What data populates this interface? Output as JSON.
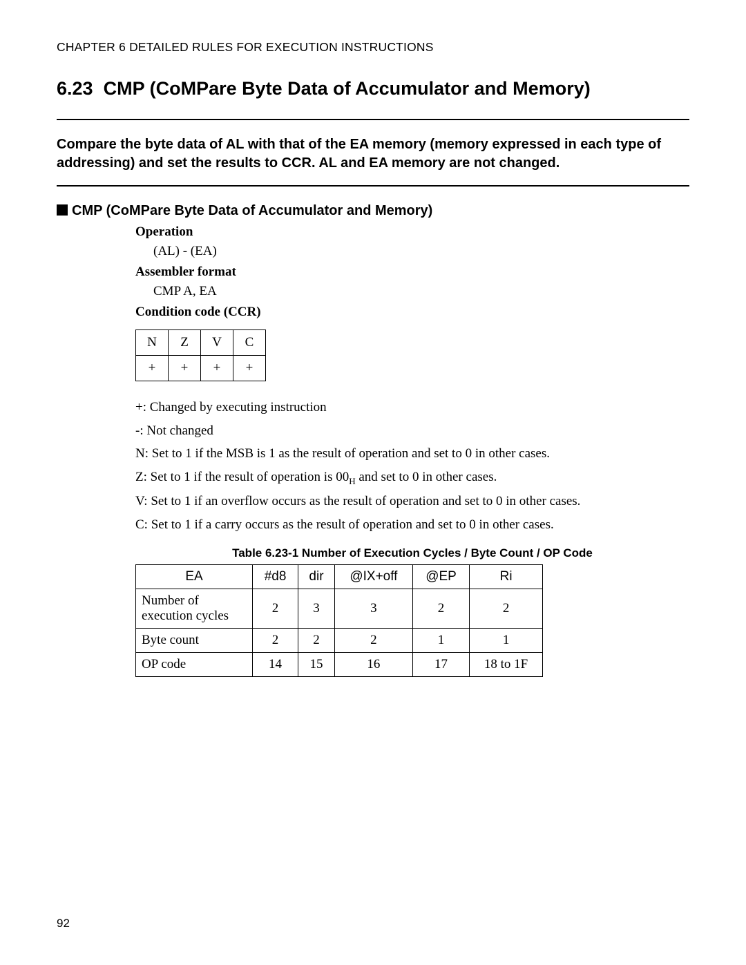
{
  "chapter_header": "CHAPTER 6  DETAILED RULES FOR EXECUTION INSTRUCTIONS",
  "section_number": "6.23",
  "section_title": "CMP (CoMPare Byte Data of Accumulator and Memory)",
  "intro_text": "Compare the byte data of AL with that of the EA memory (memory expressed in each type of addressing) and set the results to CCR. AL and EA memory are not changed.",
  "subheading": "CMP (CoMPare Byte Data of Accumulator and Memory)",
  "labels": {
    "operation": "Operation",
    "operation_value": "(AL) - (EA)",
    "assembler": "Assembler format",
    "assembler_value": "CMP A, EA",
    "condition": "Condition code (CCR)"
  },
  "ccr": {
    "headers": [
      "N",
      "Z",
      "V",
      "C"
    ],
    "values": [
      "+",
      "+",
      "+",
      "+"
    ]
  },
  "notes": {
    "plus": "+: Changed by executing instruction",
    "minus": "-: Not changed",
    "n": "N: Set to 1 if the MSB is 1 as the result of operation and set to 0 in other cases.",
    "z_pre": "Z: Set to 1 if the result of operation is 00",
    "z_sub": "H",
    "z_post": " and set to 0 in other cases.",
    "v": "V: Set to 1 if an overflow occurs as the result of operation and set to 0 in other cases.",
    "c": "C: Set to 1 if a carry occurs as the result of operation and set to 0 in other cases."
  },
  "table_caption": "Table 6.23-1  Number of Execution Cycles / Byte Count / OP Code",
  "table": {
    "headers": [
      "EA",
      "#d8",
      "dir",
      "@IX+off",
      "@EP",
      "Ri"
    ],
    "rows": [
      {
        "label": "Number of execution cycles",
        "cells": [
          "2",
          "3",
          "3",
          "2",
          "2"
        ]
      },
      {
        "label": "Byte count",
        "cells": [
          "2",
          "2",
          "2",
          "1",
          "1"
        ]
      },
      {
        "label": "OP code",
        "cells": [
          "14",
          "15",
          "16",
          "17",
          "18 to 1F"
        ]
      }
    ]
  },
  "page_number": "92"
}
